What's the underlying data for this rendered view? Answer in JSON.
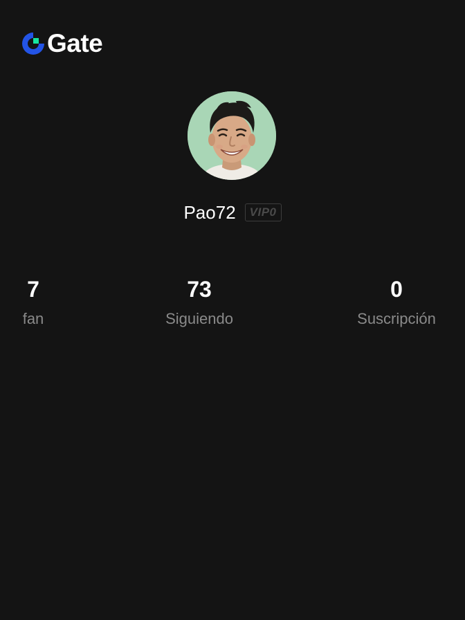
{
  "brand": {
    "name": "Gate",
    "logo_icon": "gate-logo-icon",
    "colors": {
      "blue": "#2354E6",
      "green": "#17E6A1"
    }
  },
  "profile": {
    "avatar": "user-avatar-photo",
    "username": "Pao72",
    "vip_label": "VIP0"
  },
  "stats": [
    {
      "value": "7",
      "label": "fan"
    },
    {
      "value": "73",
      "label": "Siguiendo"
    },
    {
      "value": "0",
      "label": "Suscripción"
    }
  ],
  "theme": {
    "background": "#141414",
    "text_primary": "#ffffff",
    "text_secondary": "#8a8a8a"
  }
}
